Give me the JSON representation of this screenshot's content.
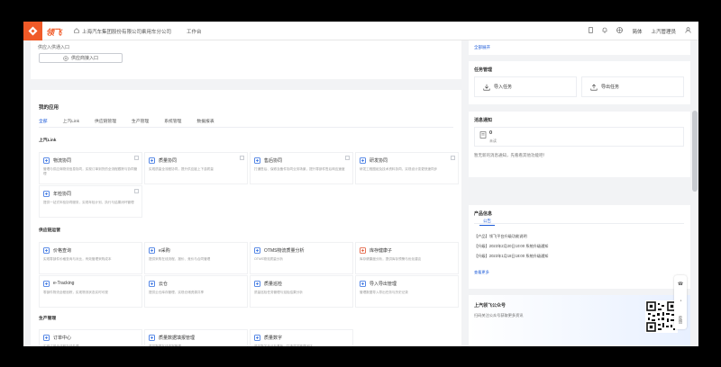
{
  "header": {
    "brand": "领飞",
    "company": "上海汽车集团股份有限公司乘用车分公司",
    "workbench": "工作台",
    "lang": "简体",
    "user": "上汽管理员"
  },
  "entry": {
    "hint": "供应入供通入口",
    "button_label": "供应商接入口"
  },
  "apps": {
    "title": "我的应用",
    "tabs": [
      "全部",
      "上汽Link",
      "供应链管理",
      "生产管理",
      "系统管理",
      "数据报表"
    ],
    "sections": {
      "link": "上汽Link",
      "ops": "供应链运营",
      "prod": "生产管理"
    },
    "tiles": [
      {
        "name": "物流协同",
        "desc": "管理与供应商物流信息协同，实现订单到货的全流程跟踪与协同管理"
      },
      {
        "name": "质量协同",
        "desc": "实现质量全流程协同，提升供应链上下游质量"
      },
      {
        "name": "售后协同",
        "desc": "打通售后、保修及备件协同业务场景，提升零部件售后响应速度"
      },
      {
        "name": "研发协同",
        "desc": "研发工程图纸及技术资料协同，实现设计变更快速同步"
      },
      {
        "name": "年检协同",
        "desc": "提供一站式年检协同服务，实现年检计划、执行与结果闭环管理"
      },
      {
        "name": "价格查询",
        "desc": "实现零部件价格查询与对比，有效管理采购成本"
      },
      {
        "name": "e采购",
        "desc": "提供采购在线流程、报价、竞价与合同管理"
      },
      {
        "name": "OTMS物流质量分析",
        "desc": "OTMS物流质量分析"
      },
      {
        "name": "库存健康子",
        "desc": "库存健康度分析，提供库存预警与优化建议"
      },
      {
        "name": "e-Tracking",
        "desc": "零部件物流全程追踪，实现物流状态实时可视"
      },
      {
        "name": "云仓",
        "desc": "提供云仓库存管理，实现仓储资源共享"
      },
      {
        "name": "质量巡检",
        "desc": "质量巡检任务管理与巡检结果分析"
      },
      {
        "name": "导入导出管理",
        "desc": "管理数据导入导出任务与历史记录"
      },
      {
        "name": "订单中心",
        "desc": "实现订单全流程在线处理"
      },
      {
        "name": "质量数据填报管理",
        "desc": "质量数据在线填报管理"
      },
      {
        "name": "质量数字",
        "desc": "质量数字化分析看板，打造质量管理闭环"
      }
    ]
  },
  "right": {
    "top_link": "全部展开",
    "task_title": "任务管理",
    "import_task": "导入任务",
    "export_task": "导出任务",
    "msg_title": "消息通知",
    "msg_count": "0",
    "msg_unit": "未读",
    "msg_text": "暂无新的消息通知，先看看其他功能吧！",
    "notice_title": "产品信息",
    "notice_tab": "公告",
    "notices": [
      "【产品】领飞平台升级功能说明",
      "【升级】2023年2月20日10:00 系统升级通知",
      "【升级】2023年1月18日18:00 系统升级通知"
    ],
    "more": "查看更多",
    "wechat_title": "上汽领飞公众号",
    "wechat_text": "扫码关注公众号获取更多资讯"
  },
  "floatbar": {
    "items": [
      "☎",
      "◔",
      "反馈"
    ]
  },
  "colors": {
    "brand": "#f05a28",
    "accent": "#1d5bd8"
  }
}
